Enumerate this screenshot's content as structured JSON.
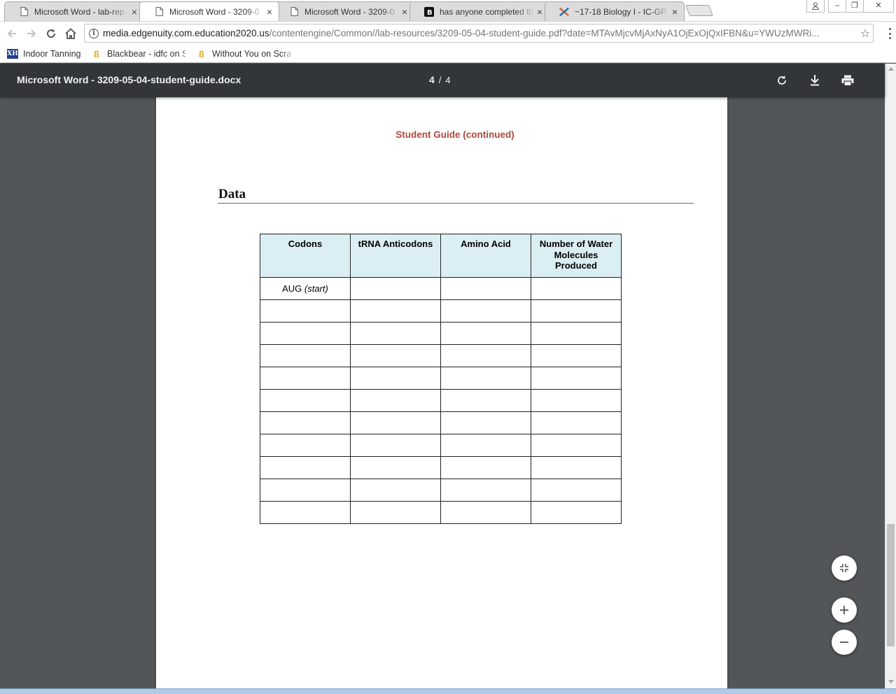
{
  "browser": {
    "tabs": [
      {
        "title": "Microsoft Word - lab-rep",
        "icon": "document-icon",
        "active": false
      },
      {
        "title": "Microsoft Word - 3209-0",
        "icon": "document-icon",
        "active": true
      },
      {
        "title": "Microsoft Word - 3209-0",
        "icon": "document-icon",
        "active": false
      },
      {
        "title": "has anyone completed th",
        "icon": "brainly-icon",
        "active": false
      },
      {
        "title": "~17-18 Biology I - IC-GP",
        "icon": "edgenuity-icon",
        "active": false
      }
    ],
    "address": {
      "host": "media.edgenuity.com.education2020.us",
      "path": "/contentengine/Common//lab-resources/3209-05-04-student-guide.pdf?date=MTAvMjcvMjAxNyA1OjExOjQxIFBN&u=YWUzMWRi..."
    },
    "bookmarks": [
      {
        "label": "Indoor Tanning",
        "icon": "xh-icon"
      },
      {
        "label": "Blackbear - idfc on Sc",
        "icon": "bookmark-coin-icon"
      },
      {
        "label": "Without You on Scrat",
        "icon": "bookmark-coin-icon"
      }
    ]
  },
  "pdf_viewer": {
    "title": "Microsoft Word - 3209-05-04-student-guide.docx",
    "current_page": "4",
    "page_separator": "/",
    "total_pages": "4"
  },
  "document": {
    "header": "Student Guide (continued)",
    "section_title": "Data",
    "table": {
      "headers": [
        "Codons",
        "tRNA Anticodons",
        "Amino Acid",
        "Number of Water Molecules Produced"
      ],
      "first_cell_text": "AUG",
      "first_cell_note": "(start)",
      "empty_rows_after_first": 10
    }
  },
  "colors": {
    "pdf_toolbar": "#323639",
    "viewer_background": "#525659",
    "table_header_fill": "#dbeef4",
    "page_header_text": "#b0473c"
  }
}
